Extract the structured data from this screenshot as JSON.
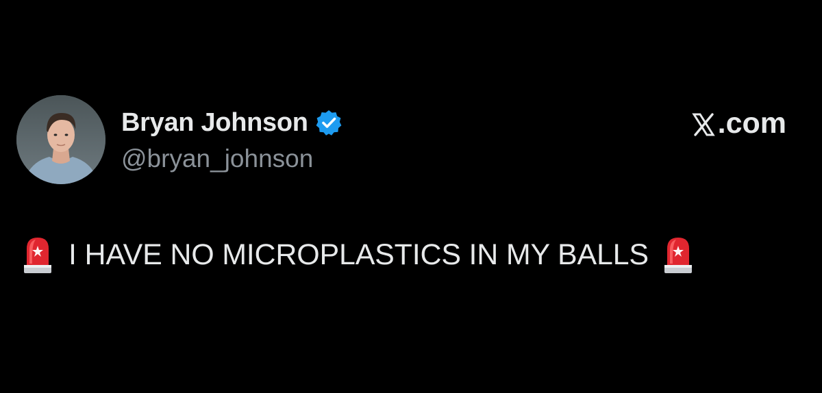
{
  "tweet": {
    "author": {
      "display_name": "Bryan Johnson",
      "handle": "@bryan_johnson",
      "verified": true,
      "avatar_icon": "profile-photo",
      "verified_icon": "verified-badge-icon"
    },
    "brand": {
      "label": ".com",
      "logo_icon": "x-logo-icon"
    },
    "body": {
      "text": "I HAVE NO MICROPLASTICS IN MY BALLS",
      "leading_icon": "police-siren-emoji",
      "trailing_icon": "police-siren-emoji"
    }
  },
  "colors": {
    "background": "#000000",
    "primary_text": "#e7e9ea",
    "secondary_text": "#8b9299",
    "verified_blue": "#1d9bf0",
    "siren_red": "#e0262f"
  }
}
